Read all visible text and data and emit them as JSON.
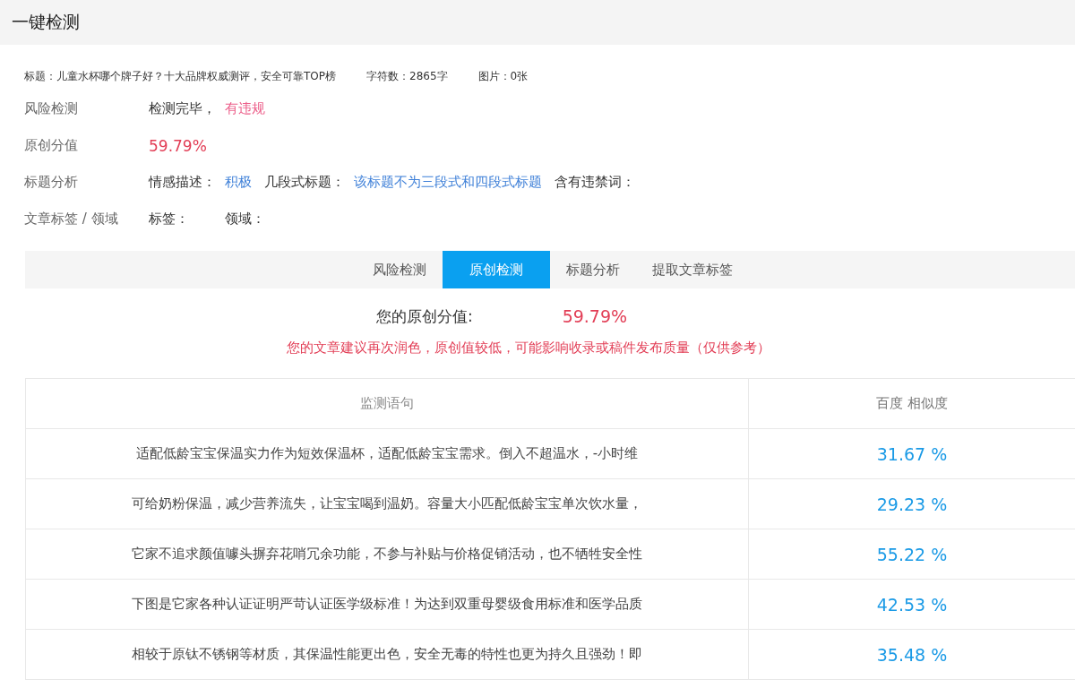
{
  "header": {
    "title": "一键检测"
  },
  "meta": [
    {
      "text": "标题：儿童水杯哪个牌子好？十大品牌权威测评，安全可靠TOP榜"
    },
    {
      "text": "字符数：2865字"
    },
    {
      "text": "图片：0张"
    }
  ],
  "analysis": [
    {
      "label": "风险检测",
      "parts": [
        {
          "kind": "plain",
          "text": "检测完毕，"
        },
        {
          "kind": "alert",
          "text": "有违规"
        }
      ]
    },
    {
      "label": "原创分值",
      "parts": [
        {
          "kind": "score",
          "text": "59.79%"
        }
      ]
    },
    {
      "label": "标题分析",
      "parts": [
        {
          "kind": "plain",
          "text": "情感描述："
        },
        {
          "kind": "info",
          "text": "积极"
        },
        {
          "kind": "plain",
          "text": "几段式标题："
        },
        {
          "kind": "info",
          "text": "该标题不为三段式和四段式标题"
        },
        {
          "kind": "plain",
          "text": "含有违禁词："
        }
      ]
    },
    {
      "label": "文章标签 / 领域",
      "parts": [
        {
          "kind": "wide",
          "text": "标签："
        },
        {
          "kind": "plain",
          "text": "领域："
        }
      ]
    }
  ],
  "tabs": [
    {
      "label": "风险检测",
      "selected": false
    },
    {
      "label": "原创检测",
      "selected": true
    },
    {
      "label": "标题分析",
      "selected": false
    },
    {
      "label": "提取文章标签",
      "selected": false
    }
  ],
  "score": {
    "label": "您的原创分值:",
    "value": "59.79%"
  },
  "warning": "您的文章建议再次润色，原创值较低，可能影响收录或稿件发布质量（仅供参考）",
  "table": {
    "columns": [
      "监测语句",
      "百度 相似度"
    ],
    "rows": [
      {
        "sentence": "适配低龄宝宝保温实力作为短效保温杯，适配低龄宝宝需求。倒入不超温水，-小时维",
        "similarity": "31.67 %"
      },
      {
        "sentence": "可给奶粉保温，减少营养流失，让宝宝喝到温奶。容量大小匹配低龄宝宝单次饮水量，",
        "similarity": "29.23 %"
      },
      {
        "sentence": "它家不追求颜值噱头摒弃花哨冗余功能，不参与补贴与价格促销活动，也不牺牲安全性",
        "similarity": "55.22 %"
      },
      {
        "sentence": "下图是它家各种认证证明严苛认证医学级标准！为达到双重母婴级食用标准和医学品质",
        "similarity": "42.53 %"
      },
      {
        "sentence": "相较于原钛不锈钢等材质，其保温性能更出色，安全无毒的特性也更为持久且强劲！即",
        "similarity": "35.48 %"
      }
    ]
  }
}
